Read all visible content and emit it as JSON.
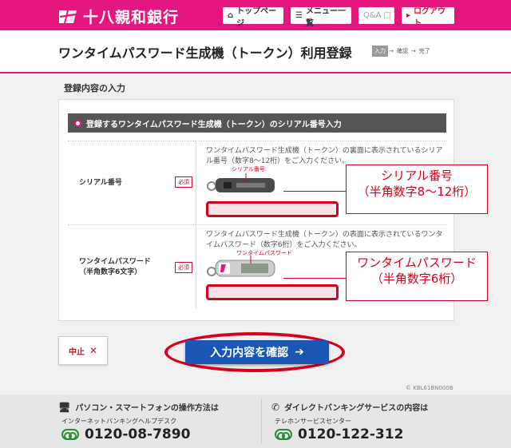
{
  "header": {
    "bank_name": "十八親和銀行",
    "nav": {
      "top_page": "トップページ",
      "menu_list": "メニュー一覧",
      "qa": "Q&A",
      "logout": "ログアウト"
    }
  },
  "title": {
    "text": "ワンタイムパスワード生成機（トークン）利用登録",
    "steps": [
      "入力",
      "確認",
      "完了"
    ],
    "active_step": "入力"
  },
  "section": {
    "title": "登録内容の入力",
    "panel_heading": "登録するワンタイムパスワード生成機（トークン）のシリアル番号入力"
  },
  "fields": {
    "serial": {
      "label": "シリアル番号",
      "required": "必須",
      "description": "ワンタイムパスワード生成機（トークン）の裏面に表示されているシリアル番号（数字8～12桁）をご入力ください。",
      "token_label": "シリアル番号",
      "value": "",
      "callout_line1": "シリアル番号",
      "callout_line2": "（半角数字8～12桁）"
    },
    "otp": {
      "label_line1": "ワンタイムパスワード",
      "label_line2": "（半角数字6文字）",
      "required": "必須",
      "description": "ワンタイムパスワード生成機（トークン）の表面に表示されているワンタイムパスワード（数字6桁）をご入力ください。",
      "token_label": "ワンタイムパスワード",
      "value": "",
      "callout_line1": "ワンタイムパスワード",
      "callout_line2": "（半角数字6桁）"
    }
  },
  "buttons": {
    "cancel": "中止",
    "confirm": "入力内容を確認"
  },
  "page_code": "KBL61BN000B",
  "footer": {
    "left": {
      "heading": "パソコン・スマートフォンの操作方法は",
      "sub": "インターネットバンキングヘルプデスク",
      "phone": "0120-08-7890"
    },
    "right": {
      "heading": "ダイレクトバンキングサービスの内容は",
      "sub": "テレホンサービスセンター",
      "phone": "0120-122-312"
    }
  },
  "colors": {
    "brand": "#e4177e",
    "alert_red": "#d6001c",
    "confirm_blue": "#1a56b3"
  }
}
